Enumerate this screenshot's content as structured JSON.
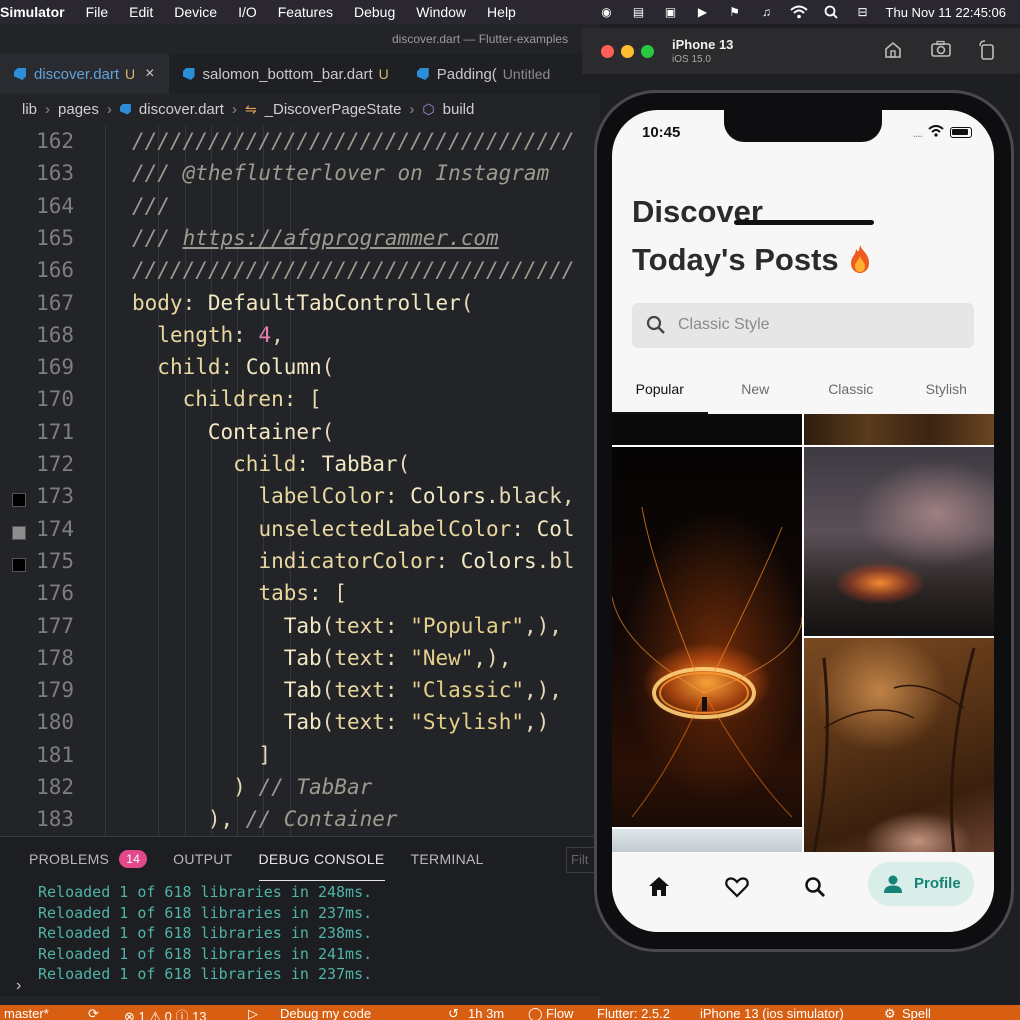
{
  "menubar": {
    "app": "Simulator",
    "items": [
      "File",
      "Edit",
      "Device",
      "I/O",
      "Features",
      "Debug",
      "Window",
      "Help"
    ],
    "clock": "Thu Nov 11  22:45:06"
  },
  "editor": {
    "window_title": "discover.dart — Flutter-examples",
    "tabs": [
      {
        "label": "discover.dart",
        "status": "U",
        "close": "×"
      },
      {
        "label": "salomon_bottom_bar.dart",
        "status": "U"
      },
      {
        "label": "Padding(",
        "status": "Untitled"
      }
    ],
    "breadcrumb": [
      "lib",
      "pages",
      "discover.dart",
      "_DiscoverPageState",
      "build"
    ],
    "lines": [
      {
        "n": "162",
        "html": "<span class='cm'>///////////////////////////////////</span>"
      },
      {
        "n": "163",
        "html": "<span class='cm'>/// @theflutterlover on Instagram</span>"
      },
      {
        "n": "164",
        "html": "<span class='cm'>///</span>"
      },
      {
        "n": "165",
        "html": "<span class='cm'>/// <span class='lnk'>https://afgprogrammer.com</span></span>"
      },
      {
        "n": "166",
        "html": "<span class='cm'>///////////////////////////////////</span>"
      },
      {
        "n": "167",
        "html": "<span class='kw'>body</span>: <span class='ty'>DefaultTabController</span>("
      },
      {
        "n": "168",
        "html": "  <span class='kw'>length</span>: <span class='num'>4</span>,"
      },
      {
        "n": "169",
        "html": "  <span class='kw'>child</span>: <span class='ty'>Column</span>("
      },
      {
        "n": "170",
        "html": "    <span class='kw'>children</span>: ["
      },
      {
        "n": "171",
        "html": "      <span class='ty'>Container</span>("
      },
      {
        "n": "172",
        "html": "        <span class='kw'>child</span>: <span class='ty'>TabBar</span>("
      },
      {
        "n": "173",
        "html": "          <span class='kw'>labelColor</span>: <span class='ty'>Colors</span>.black,",
        "swatch": "#000000"
      },
      {
        "n": "174",
        "html": "          <span class='kw'>unselectedLabelColor</span>: <span class='ty'>Col</span>",
        "swatch": "#8e8e8e"
      },
      {
        "n": "175",
        "html": "          <span class='kw'>indicatorColor</span>: <span class='ty'>Colors</span>.bl",
        "swatch": "#000000"
      },
      {
        "n": "176",
        "html": "          <span class='kw'>tabs</span>: ["
      },
      {
        "n": "177",
        "html": "            <span class='ty'>Tab</span>(<span class='kw'>text</span>: <span class='str'>\"Popular\"</span>,),"
      },
      {
        "n": "178",
        "html": "            <span class='ty'>Tab</span>(<span class='kw'>text</span>: <span class='str'>\"New\"</span>,),"
      },
      {
        "n": "179",
        "html": "            <span class='ty'>Tab</span>(<span class='kw'>text</span>: <span class='str'>\"Classic\"</span>,),"
      },
      {
        "n": "180",
        "html": "            <span class='ty'>Tab</span>(<span class='kw'>text</span>: <span class='str'>\"Stylish\"</span>,)"
      },
      {
        "n": "181",
        "html": "          ]"
      },
      {
        "n": "182",
        "html": "        ) <span class='cm'>// TabBar</span>"
      },
      {
        "n": "183",
        "html": "      ), <span class='cm'>// Container</span>"
      }
    ]
  },
  "panel": {
    "tabs": [
      {
        "label": "PROBLEMS",
        "badge": "14"
      },
      {
        "label": "OUTPUT"
      },
      {
        "label": "DEBUG CONSOLE",
        "active": true
      },
      {
        "label": "TERMINAL"
      }
    ],
    "filter_placeholder": "Filt",
    "log": [
      "Reloaded 1 of 618 libraries in 248ms.",
      "Reloaded 1 of 618 libraries in 237ms.",
      "Reloaded 1 of 618 libraries in 238ms.",
      "Reloaded 1 of 618 libraries in 241ms.",
      "Reloaded 1 of 618 libraries in 237ms."
    ],
    "prompt": "›"
  },
  "statusbar": {
    "branch": "master*",
    "problems": "⊗ 1 ⚠ 0 ⓘ 13",
    "debug": "Debug my code",
    "time": "1h 3m",
    "flow": "Flow",
    "flutter": "Flutter: 2.5.2",
    "device": "iPhone 13 (ios simulator)",
    "spell": "Spell"
  },
  "simulator": {
    "device": "iPhone 13",
    "os": "iOS 15.0"
  },
  "app": {
    "time": "10:45",
    "title_line1": "Discover",
    "title_line2": "Today's Posts",
    "search_placeholder": "Classic Style",
    "tabs": [
      "Popular",
      "New",
      "Classic",
      "Stylish"
    ],
    "selected_tab": "Popular",
    "profile_label": "Profile",
    "accent": "#148275"
  }
}
